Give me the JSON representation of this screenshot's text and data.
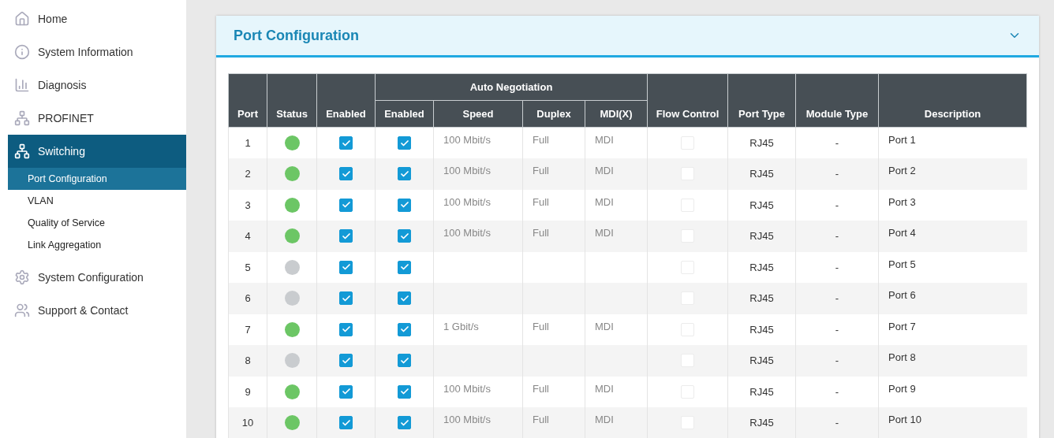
{
  "sidebar": {
    "items": [
      {
        "label": "Home",
        "selected": false
      },
      {
        "label": "System Information",
        "selected": false
      },
      {
        "label": "Diagnosis",
        "selected": false
      },
      {
        "label": "PROFINET",
        "selected": false
      },
      {
        "label": "Switching",
        "selected": true,
        "children": [
          {
            "label": "Port Configuration",
            "selected": true
          },
          {
            "label": "VLAN",
            "selected": false
          },
          {
            "label": "Quality of Service",
            "selected": false
          },
          {
            "label": "Link Aggregation",
            "selected": false
          }
        ]
      },
      {
        "label": "System Configuration",
        "selected": false
      },
      {
        "label": "Support & Contact",
        "selected": false
      }
    ]
  },
  "panel": {
    "title": "Port Configuration",
    "expanded": true,
    "table": {
      "group_heading": "Auto Negotiation",
      "columns": [
        "Port",
        "Status",
        "Enabled",
        "Enabled",
        "Speed",
        "Duplex",
        "MDI(X)",
        "Flow Control",
        "Port Type",
        "Module Type",
        "Description"
      ],
      "rows": [
        {
          "port": "1",
          "link_up": true,
          "enabled": true,
          "auto_negotiation": true,
          "speed": "100 Mbit/s",
          "duplex": "Full",
          "mdi": "MDI",
          "flow_control": false,
          "port_type": "RJ45",
          "module_type": "-",
          "description": "Port 1"
        },
        {
          "port": "2",
          "link_up": true,
          "enabled": true,
          "auto_negotiation": true,
          "speed": "100 Mbit/s",
          "duplex": "Full",
          "mdi": "MDI",
          "flow_control": false,
          "port_type": "RJ45",
          "module_type": "-",
          "description": "Port 2"
        },
        {
          "port": "3",
          "link_up": true,
          "enabled": true,
          "auto_negotiation": true,
          "speed": "100 Mbit/s",
          "duplex": "Full",
          "mdi": "MDI",
          "flow_control": false,
          "port_type": "RJ45",
          "module_type": "-",
          "description": "Port 3"
        },
        {
          "port": "4",
          "link_up": true,
          "enabled": true,
          "auto_negotiation": true,
          "speed": "100 Mbit/s",
          "duplex": "Full",
          "mdi": "MDI",
          "flow_control": false,
          "port_type": "RJ45",
          "module_type": "-",
          "description": "Port 4"
        },
        {
          "port": "5",
          "link_up": false,
          "enabled": true,
          "auto_negotiation": true,
          "flow_control": false,
          "port_type": "RJ45",
          "module_type": "-",
          "description": "Port 5"
        },
        {
          "port": "6",
          "link_up": false,
          "enabled": true,
          "auto_negotiation": true,
          "flow_control": false,
          "port_type": "RJ45",
          "module_type": "-",
          "description": "Port 6"
        },
        {
          "port": "7",
          "link_up": true,
          "enabled": true,
          "auto_negotiation": true,
          "speed": "1 Gbit/s",
          "duplex": "Full",
          "mdi": "MDI",
          "flow_control": false,
          "port_type": "RJ45",
          "module_type": "-",
          "description": "Port 7"
        },
        {
          "port": "8",
          "link_up": false,
          "enabled": true,
          "auto_negotiation": true,
          "flow_control": false,
          "port_type": "RJ45",
          "module_type": "-",
          "description": "Port 8"
        },
        {
          "port": "9",
          "link_up": true,
          "enabled": true,
          "auto_negotiation": true,
          "speed": "100 Mbit/s",
          "duplex": "Full",
          "mdi": "MDI",
          "flow_control": false,
          "port_type": "RJ45",
          "module_type": "-",
          "description": "Port 9"
        },
        {
          "port": "10",
          "link_up": true,
          "enabled": true,
          "auto_negotiation": true,
          "speed": "100 Mbit/s",
          "duplex": "Full",
          "mdi": "MDI",
          "flow_control": false,
          "port_type": "RJ45",
          "module_type": "-",
          "description": "Port 10"
        }
      ]
    }
  }
}
